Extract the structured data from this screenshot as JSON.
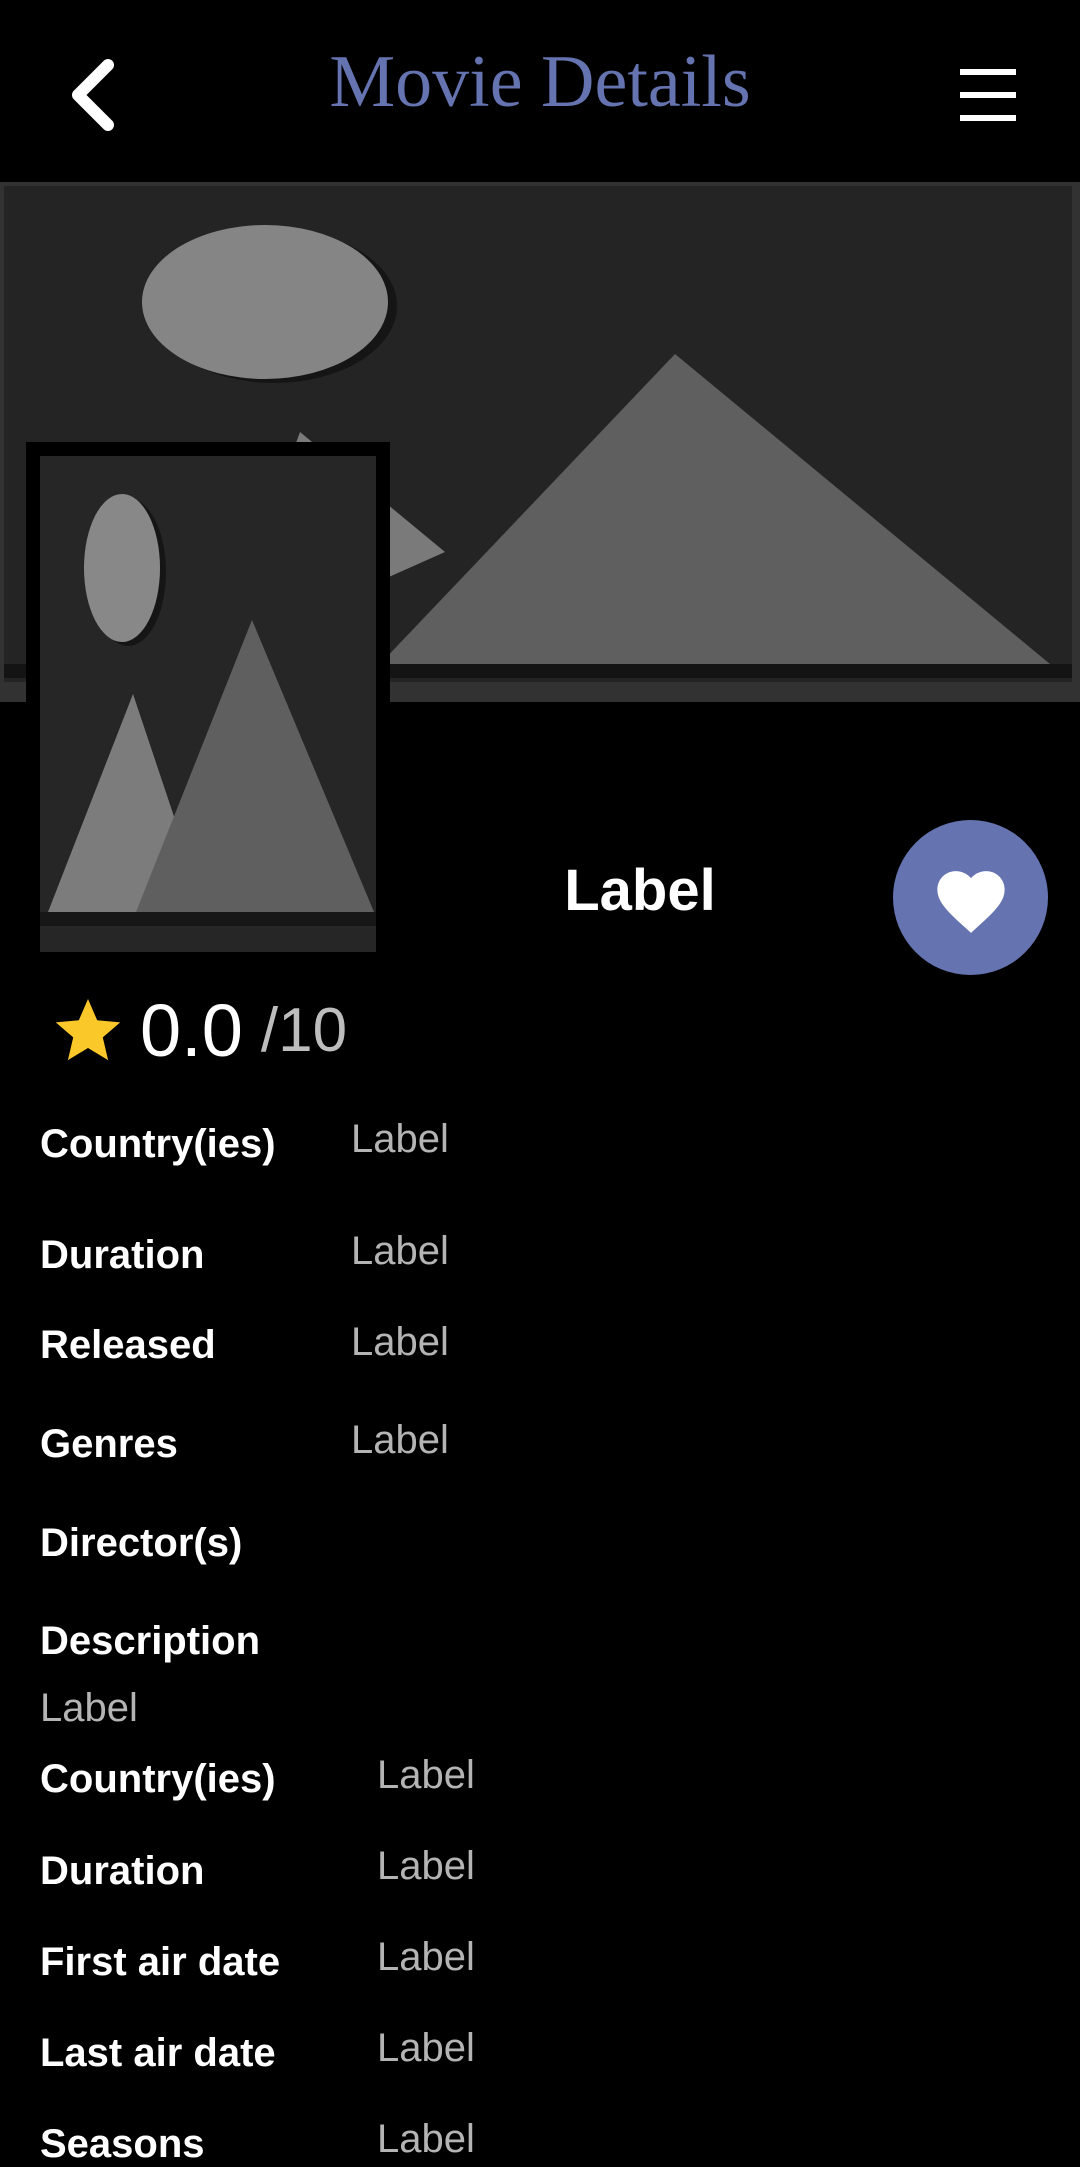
{
  "header": {
    "title": "Movie Details",
    "back_icon": "chevron-left-icon",
    "menu_icon": "hamburger-menu-icon"
  },
  "movie": {
    "name": "Label",
    "rating": "0.0",
    "rating_max": "/10",
    "favorite_icon": "heart-icon",
    "star_icon": "star-icon"
  },
  "details": {
    "country_label": "Country(ies)",
    "country_value": "Label",
    "duration_label": "Duration",
    "duration_value": "Label",
    "released_label": "Released",
    "released_value": "Label",
    "genres_label": "Genres",
    "genres_value": "Label",
    "directors_label": "Director(s)",
    "description_label": "Description",
    "description_value": "Label"
  },
  "tv_details": {
    "country_label": "Country(ies)",
    "country_value": "Label",
    "duration_label": "Duration",
    "duration_value": "Label",
    "first_air_label": "First air date",
    "first_air_value": "Label",
    "last_air_label": "Last air date",
    "last_air_value": "Label",
    "seasons_label": "Seasons",
    "seasons_value": "Label"
  },
  "colors": {
    "accent": "#6574b0",
    "background": "#000000",
    "star": "#fbc82a",
    "muted_text": "#b4b4b4"
  }
}
